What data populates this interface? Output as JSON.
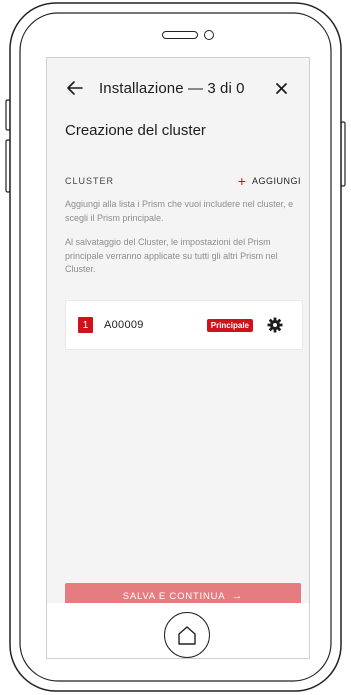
{
  "header": {
    "title": "Installazione — 3 di 0"
  },
  "page": {
    "title": "Creazione del cluster"
  },
  "cluster": {
    "label": "Cluster",
    "add_label": "AGGIUNGI",
    "add_icon": "+",
    "description_1": "Aggiungi alla lista i Prism che vuoi includere nel cluster, e scegli il Prism principale.",
    "description_2": "Al salvataggio del Cluster, le impostazioni del Prism principale verranno applicate su tutti gli altri Prism nel Cluster."
  },
  "prisms": [
    {
      "index": "1",
      "name": "A00009",
      "badge": "Principale"
    }
  ],
  "footer": {
    "save_label": "SALVA E CONTINUA",
    "save_arrow": "→"
  },
  "colors": {
    "accent": "#d0121b",
    "button_disabled": "#e57c80",
    "screen_background": "#f4f4f4"
  },
  "icons": {
    "back": "arrow-left-icon",
    "close": "close-icon",
    "settings": "gear-icon",
    "home": "home-button-icon"
  }
}
